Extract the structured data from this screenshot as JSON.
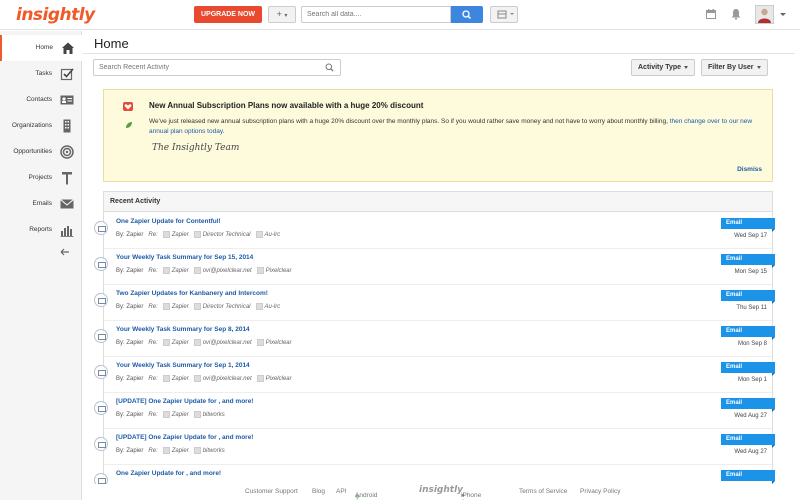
{
  "app": {
    "logo": "insightly",
    "upgrade_label": "UPGRADE NOW",
    "plus_label": "+",
    "search_placeholder": "Search all data...."
  },
  "sidebar": {
    "items": [
      {
        "label": "Home",
        "icon": "home-icon"
      },
      {
        "label": "Tasks",
        "icon": "tasks-icon"
      },
      {
        "label": "Contacts",
        "icon": "contacts-icon"
      },
      {
        "label": "Organizations",
        "icon": "organizations-icon"
      },
      {
        "label": "Opportunities",
        "icon": "opportunities-icon"
      },
      {
        "label": "Projects",
        "icon": "projects-icon"
      },
      {
        "label": "Emails",
        "icon": "emails-icon"
      },
      {
        "label": "Reports",
        "icon": "reports-icon"
      }
    ]
  },
  "main": {
    "title": "Home",
    "activity_search_placeholder": "Search Recent Activity",
    "activity_type_label": "Activity Type",
    "filter_user_label": "Filter By User"
  },
  "announcement": {
    "title": "New Annual Subscription Plans now available with a huge 20% discount",
    "body_1": "We've just released new annual subscription plans with a huge 20% discount over the monthly plans. So if you would rather save money and not have to worry about monthly billing, ",
    "link": "then change over to our new annual plan options today.",
    "signature": "The Insightly Team",
    "dismiss": "Dismiss"
  },
  "recent_activity": {
    "heading": "Recent Activity",
    "rows": [
      {
        "title": "One Zapier Update for Contentful!",
        "by": "By: Zapier",
        "re": "Re:",
        "c1": "Zapier",
        "c2": "Director Technical",
        "c3": "Au-lrc",
        "badge": "Email",
        "date": "Wed Sep 17"
      },
      {
        "title": "Your Weekly Task Summary for Sep 15, 2014",
        "by": "By: Zapier",
        "re": "Re:",
        "c1": "Zapier",
        "c2": "ovi@pixelclear.net",
        "c3": "Pixelclear",
        "badge": "Email",
        "date": "Mon Sep 15"
      },
      {
        "title": "Two Zapier Updates for Kanbanery and Intercom!",
        "by": "By: Zapier",
        "re": "Re:",
        "c1": "Zapier",
        "c2": "Director Technical",
        "c3": "Au-lrc",
        "badge": "Email",
        "date": "Thu Sep 11"
      },
      {
        "title": "Your Weekly Task Summary for Sep 8, 2014",
        "by": "By: Zapier",
        "re": "Re:",
        "c1": "Zapier",
        "c2": "ovi@pixelclear.net",
        "c3": "Pixelclear",
        "badge": "Email",
        "date": "Mon Sep 8"
      },
      {
        "title": "Your Weekly Task Summary for Sep 1, 2014",
        "by": "By: Zapier",
        "re": "Re:",
        "c1": "Zapier",
        "c2": "ovi@pixelclear.net",
        "c3": "Pixelclear",
        "badge": "Email",
        "date": "Mon Sep 1"
      },
      {
        "title": "[UPDATE] One Zapier Update for , and more!",
        "by": "By: Zapier",
        "re": "Re:",
        "c1": "Zapier",
        "c2": "bitworks",
        "c3": "",
        "badge": "Email",
        "date": "Wed Aug 27"
      },
      {
        "title": "[UPDATE] One Zapier Update for , and more!",
        "by": "By: Zapier",
        "re": "Re:",
        "c1": "Zapier",
        "c2": "bitworks",
        "c3": "",
        "badge": "Email",
        "date": "Wed Aug 27"
      },
      {
        "title": "One Zapier Update for , and more!",
        "by": "",
        "re": "",
        "c1": "",
        "c2": "",
        "c3": "",
        "badge": "Email",
        "date": ""
      }
    ]
  },
  "footer": {
    "customer_support": "Customer Support",
    "blog": "Blog",
    "api": "API",
    "android": "Android App",
    "logo": "insightly",
    "iphone": "iPhone App",
    "terms": "Terms of Service",
    "privacy": "Privacy Policy"
  },
  "colors": {
    "brand": "#f05a28",
    "upgrade": "#e8492f",
    "search_button": "#3d86e0",
    "link": "#1d5ba8",
    "badge": "#1a93e8",
    "announcement_bg": "#fdfbdc"
  }
}
